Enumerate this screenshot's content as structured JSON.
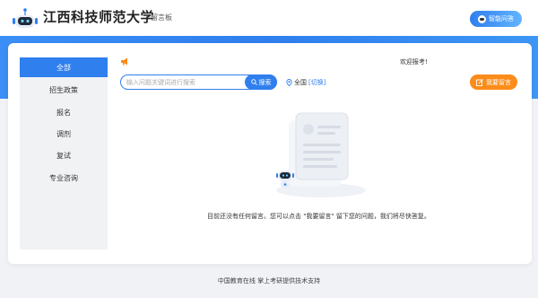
{
  "header": {
    "site_title": "江西科技师范大学",
    "board_label": "留言板",
    "smart_button": "智能问答"
  },
  "sidebar": {
    "items": [
      {
        "label": "全部",
        "active": true
      },
      {
        "label": "招生政策",
        "active": false
      },
      {
        "label": "报名",
        "active": false
      },
      {
        "label": "调剂",
        "active": false
      },
      {
        "label": "复试",
        "active": false
      },
      {
        "label": "专业咨询",
        "active": false
      }
    ]
  },
  "main": {
    "welcome": "欢迎报考!",
    "search": {
      "placeholder": "输入问题关键词进行搜索",
      "button_label": "搜索"
    },
    "location": {
      "value": "全国",
      "switch_label": "[切换]"
    },
    "leave_message_button": "我要留言",
    "empty_message": "目前还没有任何留言。您可以点击 \"我要留言\" 留下您的问题，我们将尽快答复。"
  },
  "footer": {
    "text": "中国教育在线 掌上考研提供技术支持"
  },
  "colors": {
    "primary": "#2f7fee",
    "accent_orange": "#fb8c1a",
    "sidebar_bg": "#f1f2f4"
  }
}
